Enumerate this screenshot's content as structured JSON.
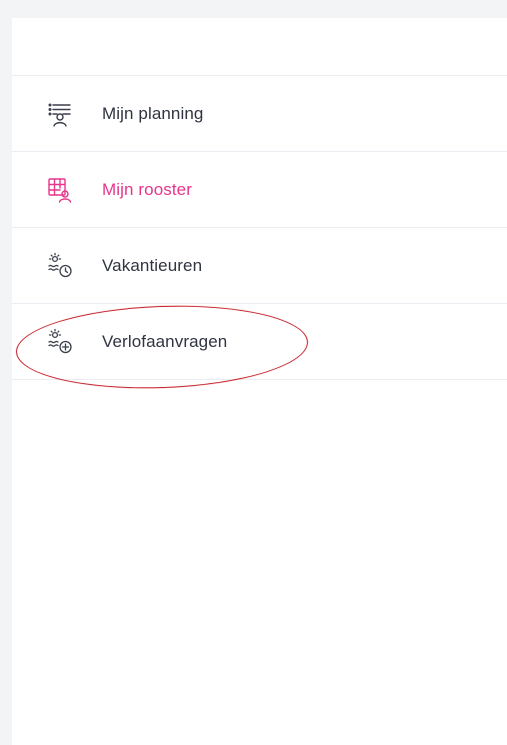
{
  "menu": {
    "items": [
      {
        "label": "Mijn planning",
        "icon": "planning-list-person-icon"
      },
      {
        "label": "Mijn rooster",
        "icon": "roster-grid-person-icon",
        "active": true,
        "color": "#e8358b"
      },
      {
        "label": "Vakantieuren",
        "icon": "sun-clock-icon"
      },
      {
        "label": "Verlofaanvragen",
        "icon": "sun-plus-icon"
      }
    ]
  },
  "annotation": {
    "type": "red-ellipse",
    "target": "Verlofaanvragen",
    "color": "#c8232c"
  }
}
